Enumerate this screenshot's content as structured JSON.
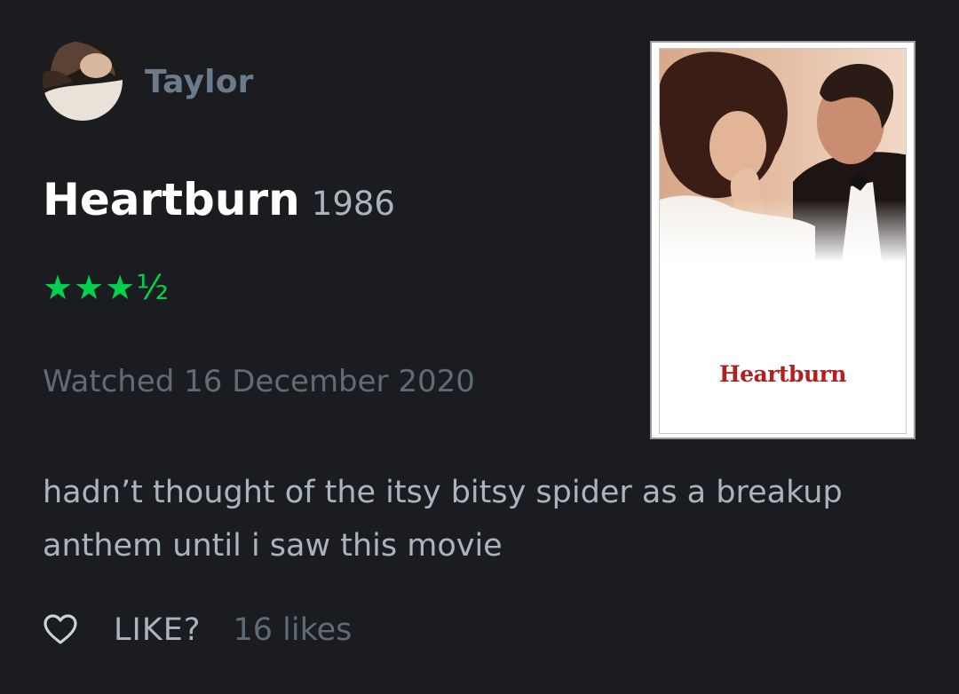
{
  "user": {
    "name": "Taylor"
  },
  "film": {
    "title": "Heartburn",
    "year": "1986",
    "poster_title": "Heartburn"
  },
  "rating": {
    "stars": 3.5,
    "display": "★★★½"
  },
  "watched": {
    "text": "Watched 16 December 2020"
  },
  "review": {
    "text": "hadn’t thought of the itsy bitsy spider as a breakup anthem until i saw this movie"
  },
  "actions": {
    "like_label": "LIKE?",
    "likes_text": "16 likes"
  },
  "colors": {
    "background": "#1a1c20",
    "star_green": "#00d24f",
    "poster_title_red": "#b0201f"
  }
}
